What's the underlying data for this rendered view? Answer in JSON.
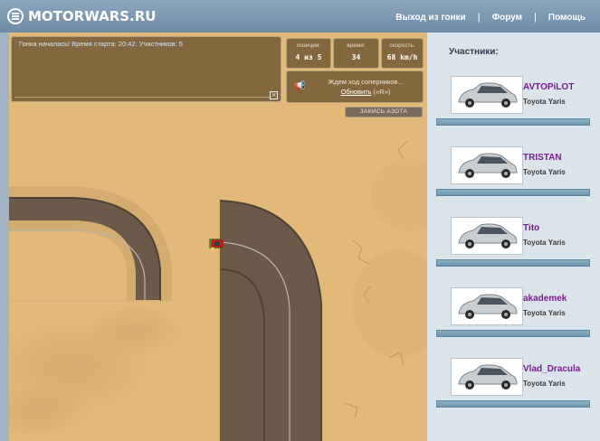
{
  "header": {
    "logo_text": "MOTORWARS.RU",
    "nav": {
      "exit_label": "Выход из гонки",
      "forum_label": "Форум",
      "help_label": "Помощь",
      "separator": "|"
    }
  },
  "game": {
    "log_message": "Гонка началась! Время старта: 20:42. Участников: 5",
    "stats": {
      "position_label": "позиция:",
      "position_value": "4 из 5",
      "time_label": "время:",
      "time_value": "34",
      "speed_label": "скорость:",
      "speed_value": "68 km/h"
    },
    "wait_message": "Ждем ход соперников...",
    "refresh_label": "Обновить",
    "refresh_hotkey": "(«R»)",
    "nitro_label": "ЗАКИСЬ АЗОТА",
    "close_glyph": "×",
    "horn_glyph": "📢"
  },
  "sidebar": {
    "title": "Участники:",
    "players": [
      {
        "name": "AVTOPiLOT",
        "car": "Toyota Yaris"
      },
      {
        "name": "TRISTAN",
        "car": "Toyota Yaris"
      },
      {
        "name": "Tito",
        "car": "Toyota Yaris"
      },
      {
        "name": "akademek",
        "car": "Toyota Yaris"
      },
      {
        "name": "Vlad_Dracula",
        "car": "Toyota Yaris"
      }
    ]
  },
  "colors": {
    "sand": "#e0b577",
    "road": "#6b5a49",
    "player_name": "#7a1b8f",
    "sidebar_bg": "#dbe4eb"
  }
}
